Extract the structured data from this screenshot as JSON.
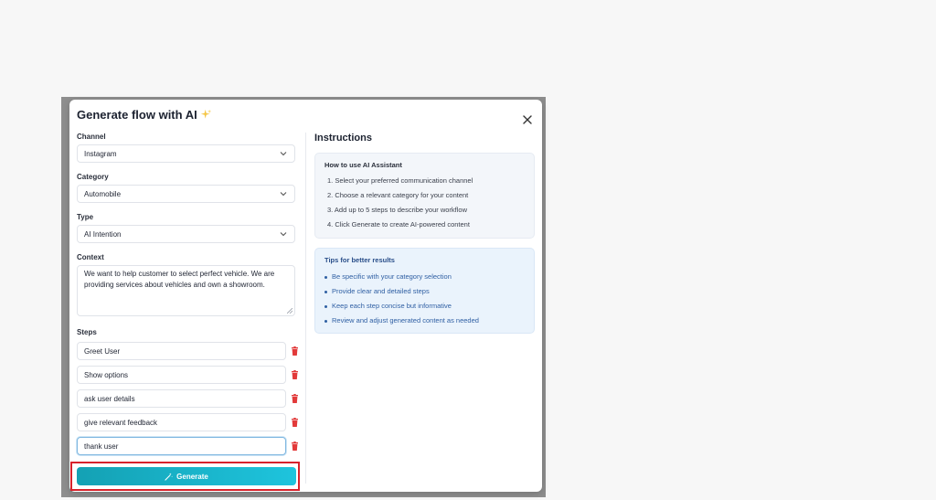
{
  "modal": {
    "title": "Generate flow with AI",
    "sparkle_icon": "sparkle-icon",
    "close_icon": "close-icon"
  },
  "form": {
    "channel": {
      "label": "Channel",
      "value": "Instagram"
    },
    "category": {
      "label": "Category",
      "value": "Automobile"
    },
    "type": {
      "label": "Type",
      "value": "AI Intention"
    },
    "context": {
      "label": "Context",
      "value": "We want to help customer to select perfect vehicle. We are providing services about vehicles and own a showroom."
    },
    "steps_label": "Steps",
    "steps": [
      "Greet User",
      "Show options",
      "ask user details",
      "give relevant feedback",
      "thank user"
    ],
    "generate_label": "Generate"
  },
  "instructions": {
    "title": "Instructions",
    "how_title": "How to use AI Assistant",
    "how_items": [
      "1. Select your preferred communication channel",
      "2. Choose a relevant category for your content",
      "3. Add up to 5 steps to describe your workflow",
      "4. Click Generate to create AI-powered content"
    ],
    "tips_title": "Tips for better results",
    "tips_items": [
      "Be specific with your category selection",
      "Provide clear and detailed steps",
      "Keep each step concise but informative",
      "Review and adjust generated content as needed"
    ]
  },
  "colors": {
    "accent": "#1ab3c9",
    "highlight_border": "#d7222b",
    "delete": "#e23a3a",
    "tips_text": "#2f5fa3"
  }
}
